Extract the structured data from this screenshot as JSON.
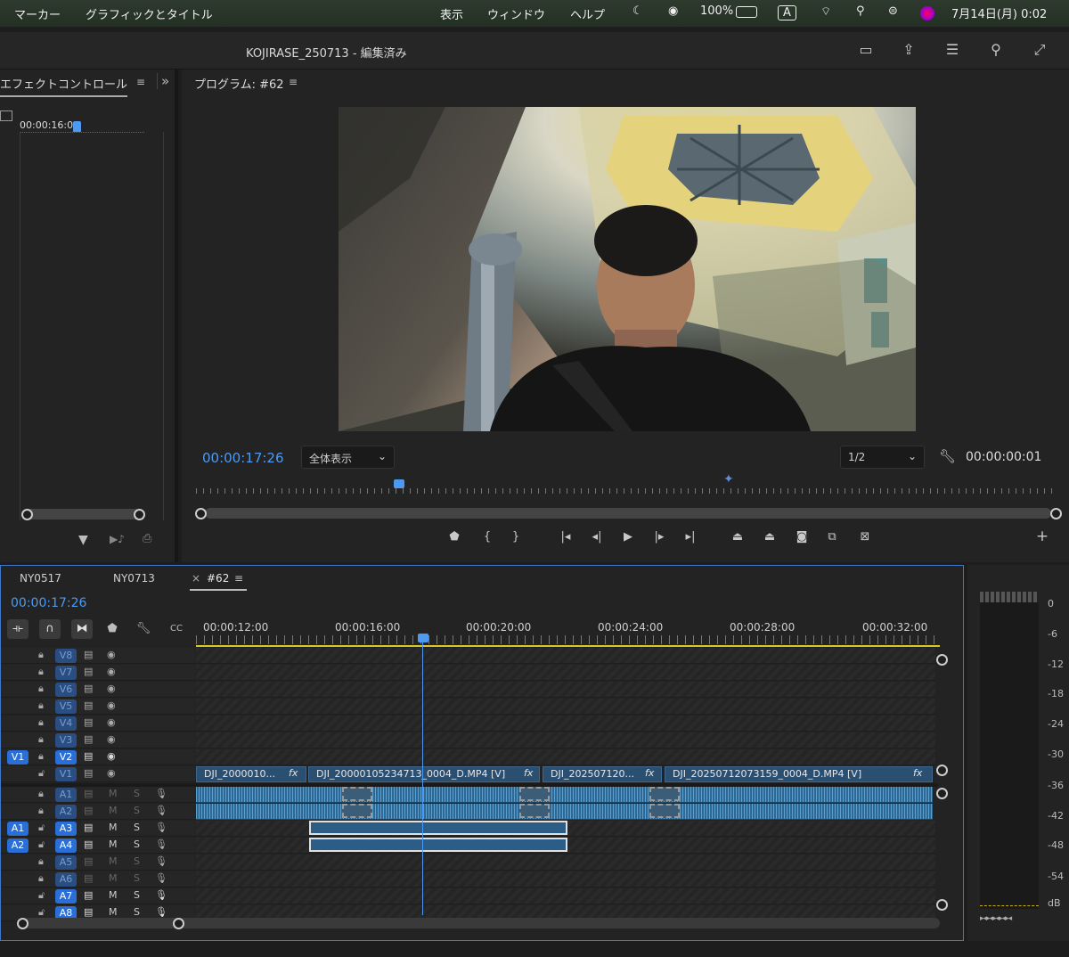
{
  "menubar": {
    "menus": [
      "マーカー",
      "グラフィックとタイトル",
      "表示",
      "ウィンドウ",
      "ヘルプ"
    ],
    "battery": "100%",
    "input_mode": "A",
    "clock": "7月14日(月) 0:02"
  },
  "window": {
    "title": "KOJIRASE_250713 - 編集済み"
  },
  "effect_controls": {
    "title": "エフェクトコントロール",
    "timecode": "00:00:16:00"
  },
  "program": {
    "title": "プログラム: #62",
    "current_time": "00:00:17:26",
    "zoom": "全体表示",
    "resolution": "1/2",
    "duration": "00:00:00:01"
  },
  "timeline": {
    "tabs": [
      "NY0517",
      "NY0713",
      "#62"
    ],
    "active_tab": "#62",
    "current_time": "00:00:17:26",
    "ruler": [
      "00:00:12:00",
      "00:00:16:00",
      "00:00:20:00",
      "00:00:24:00",
      "00:00:28:00",
      "00:00:32:00"
    ],
    "video_tracks": [
      "V8",
      "V7",
      "V6",
      "V5",
      "V4",
      "V3",
      "V2",
      "V1"
    ],
    "audio_tracks": [
      "A1",
      "A2",
      "A3",
      "A4",
      "A5",
      "A6",
      "A7",
      "A8"
    ],
    "source_v": "V1",
    "source_a1": "A1",
    "source_a2": "A2",
    "mute": "M",
    "solo": "S",
    "clips": {
      "c1": "DJI_2000010...",
      "c2": "DJI_20000105234713_0004_D.MP4 [V]",
      "c3": "DJI_202507120...",
      "c4": "DJI_20250712073159_0004_D.MP4 [V]",
      "fx": "fx"
    }
  },
  "meter": {
    "scale": [
      "0",
      "-6",
      "-12",
      "-18",
      "-24",
      "-30",
      "-36",
      "-42",
      "-48",
      "-54",
      "dB"
    ]
  }
}
